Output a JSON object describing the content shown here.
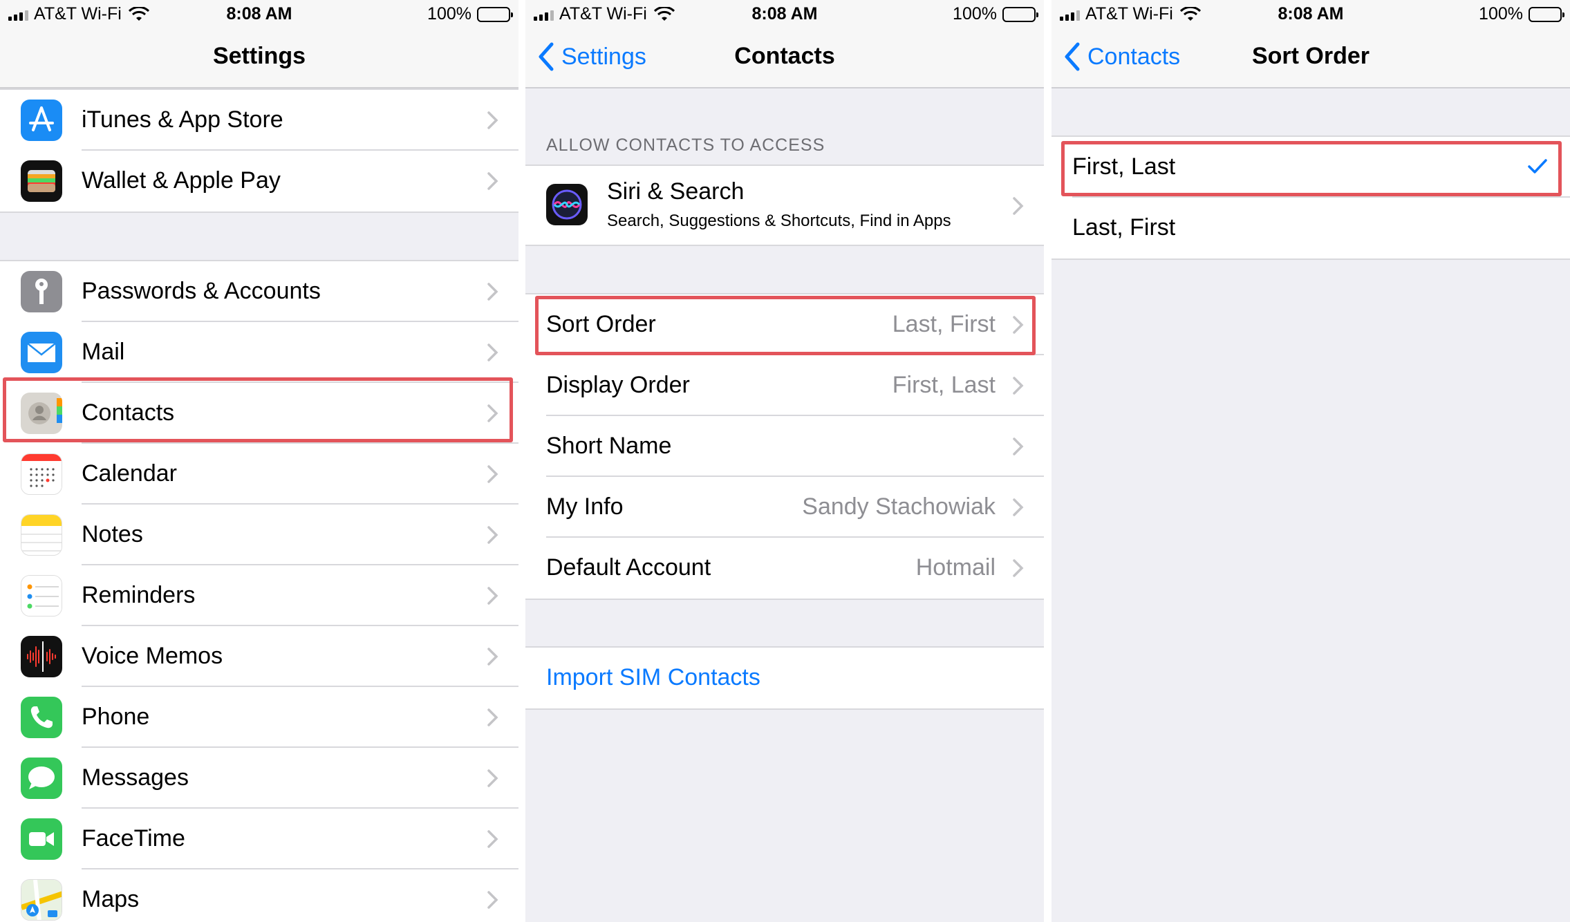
{
  "status": {
    "carrier": "AT&T Wi-Fi",
    "time": "8:08 AM",
    "battery": "100%"
  },
  "settings": {
    "title": "Settings",
    "group1": [
      {
        "label": "iTunes & App Store",
        "icon": "app-store-icon"
      },
      {
        "label": "Wallet & Apple Pay",
        "icon": "wallet-icon"
      }
    ],
    "group2": [
      {
        "label": "Passwords & Accounts",
        "icon": "key-icon"
      },
      {
        "label": "Mail",
        "icon": "mail-icon"
      },
      {
        "label": "Contacts",
        "icon": "contacts-icon"
      },
      {
        "label": "Calendar",
        "icon": "calendar-icon"
      },
      {
        "label": "Notes",
        "icon": "notes-icon"
      },
      {
        "label": "Reminders",
        "icon": "reminders-icon"
      },
      {
        "label": "Voice Memos",
        "icon": "voice-memos-icon"
      },
      {
        "label": "Phone",
        "icon": "phone-icon"
      },
      {
        "label": "Messages",
        "icon": "messages-icon"
      },
      {
        "label": "FaceTime",
        "icon": "facetime-icon"
      },
      {
        "label": "Maps",
        "icon": "maps-icon"
      }
    ]
  },
  "contacts": {
    "back_label": "Settings",
    "title": "Contacts",
    "section_header": "ALLOW CONTACTS TO ACCESS",
    "siri": {
      "label": "Siri & Search",
      "sublabel": "Search, Suggestions & Shortcuts, Find in Apps",
      "icon": "siri-icon"
    },
    "rows": [
      {
        "label": "Sort Order",
        "value": "Last, First"
      },
      {
        "label": "Display Order",
        "value": "First, Last"
      },
      {
        "label": "Short Name",
        "value": ""
      },
      {
        "label": "My Info",
        "value": "Sandy Stachowiak"
      },
      {
        "label": "Default Account",
        "value": "Hotmail"
      }
    ],
    "import_label": "Import SIM Contacts"
  },
  "sort_order": {
    "back_label": "Contacts",
    "title": "Sort Order",
    "options": [
      {
        "label": "First, Last",
        "selected": true
      },
      {
        "label": "Last, First",
        "selected": false
      }
    ]
  },
  "colors": {
    "accent": "#0a7aff",
    "highlight": "#e3545a",
    "background": "#efeff4"
  }
}
